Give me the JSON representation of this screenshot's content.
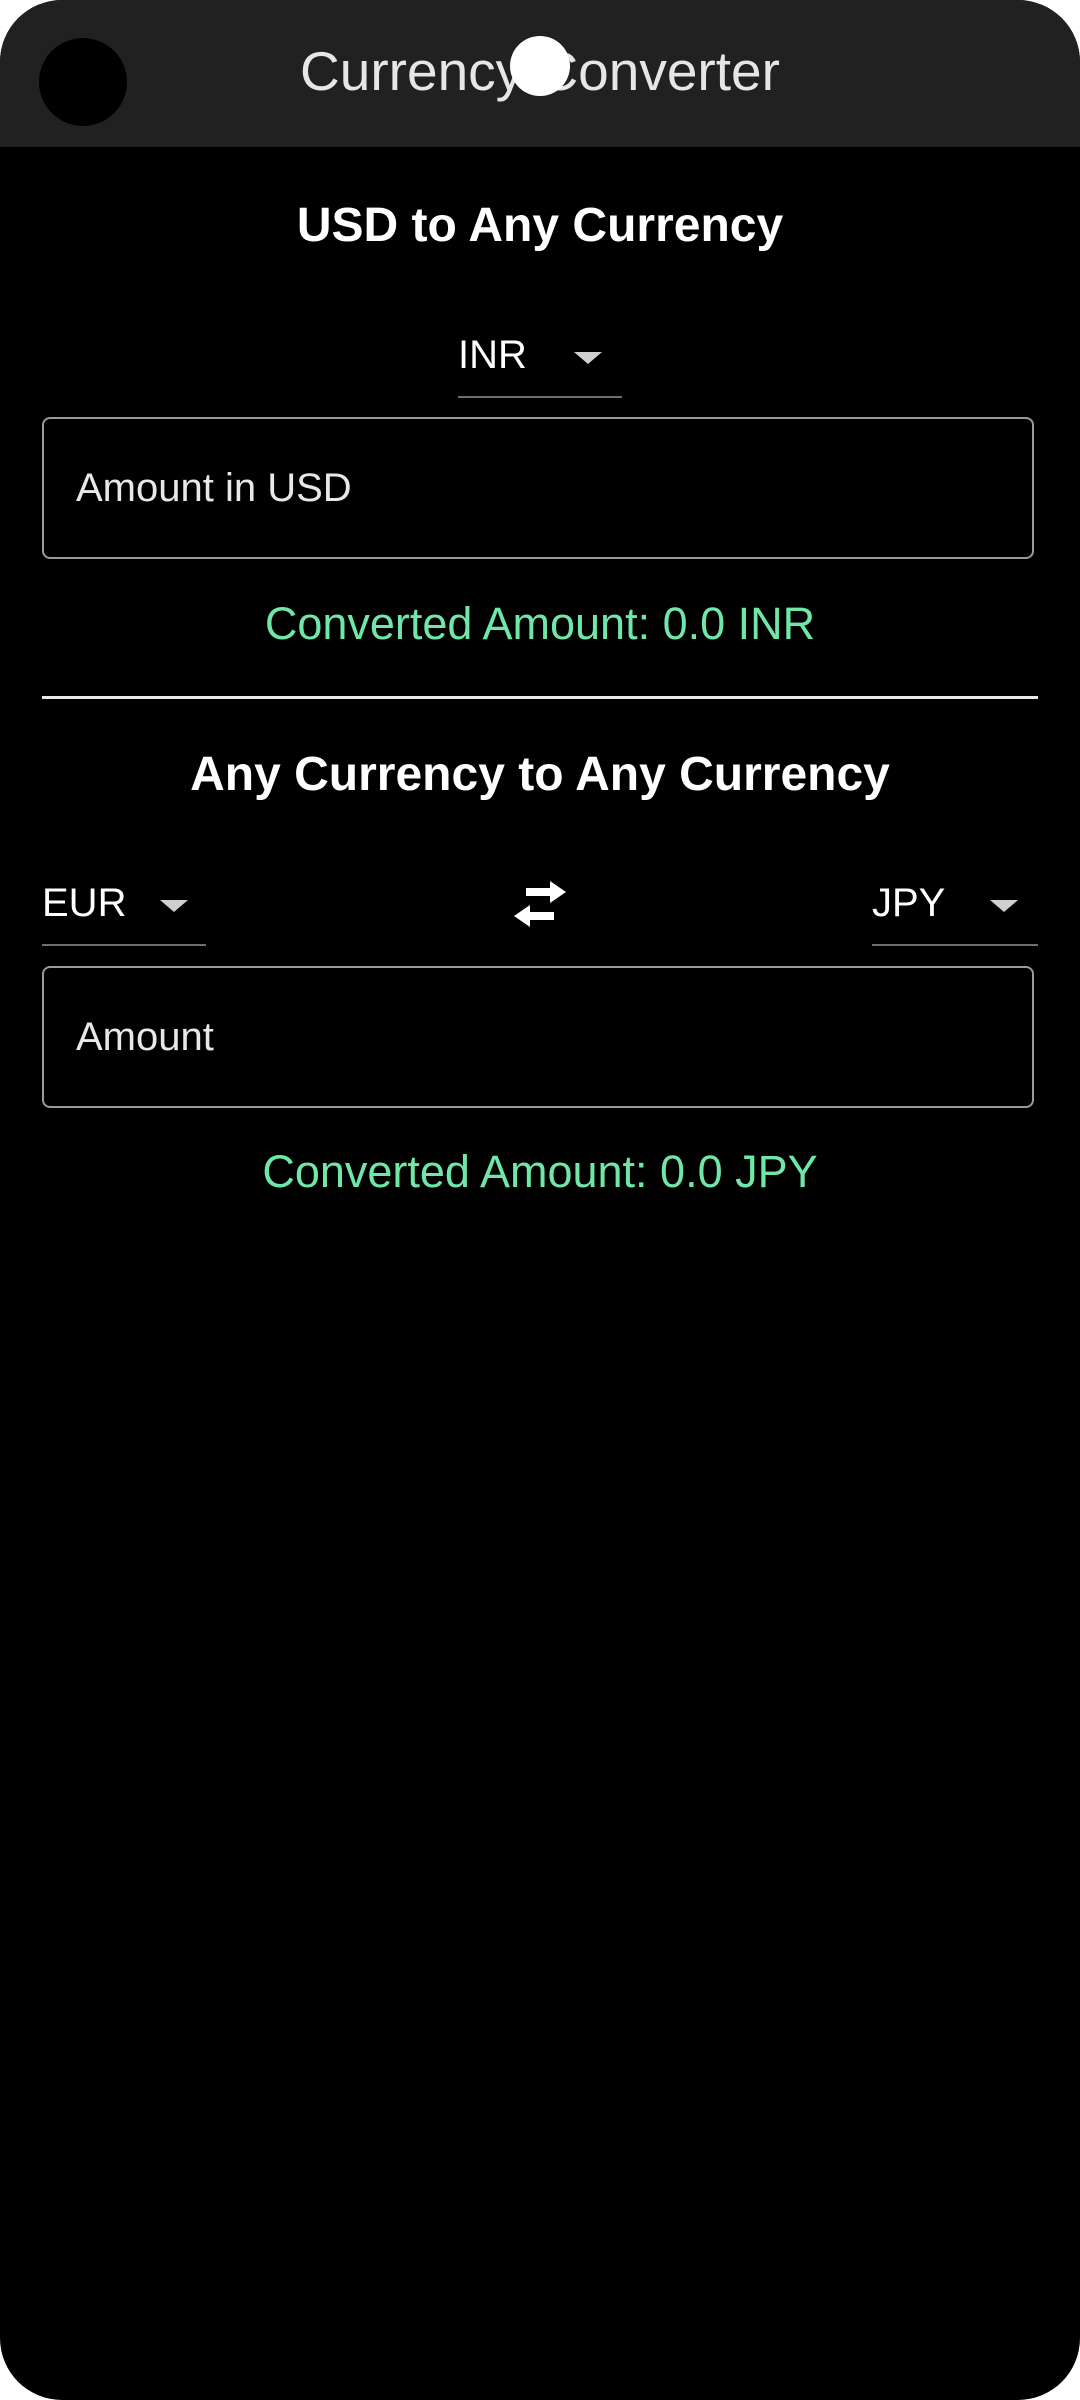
{
  "app_bar": {
    "title": "Currency Converter"
  },
  "usd_section": {
    "heading": "USD to Any Currency",
    "target_currency": "INR",
    "amount_placeholder": "Amount in USD",
    "result_text": "Converted Amount: 0.0 INR"
  },
  "any_section": {
    "heading": "Any Currency to Any Currency",
    "from_currency": "EUR",
    "to_currency": "JPY",
    "amount_placeholder": "Amount",
    "result_text": "Converted Amount: 0.0 JPY"
  },
  "icons": {
    "swap": "swap-horizontal-icon",
    "dropdown": "arrow-drop-down-icon"
  },
  "colors": {
    "background": "#000000",
    "app_bar": "#212121",
    "result_text": "#6ee7a8",
    "text": "#ffffff"
  }
}
